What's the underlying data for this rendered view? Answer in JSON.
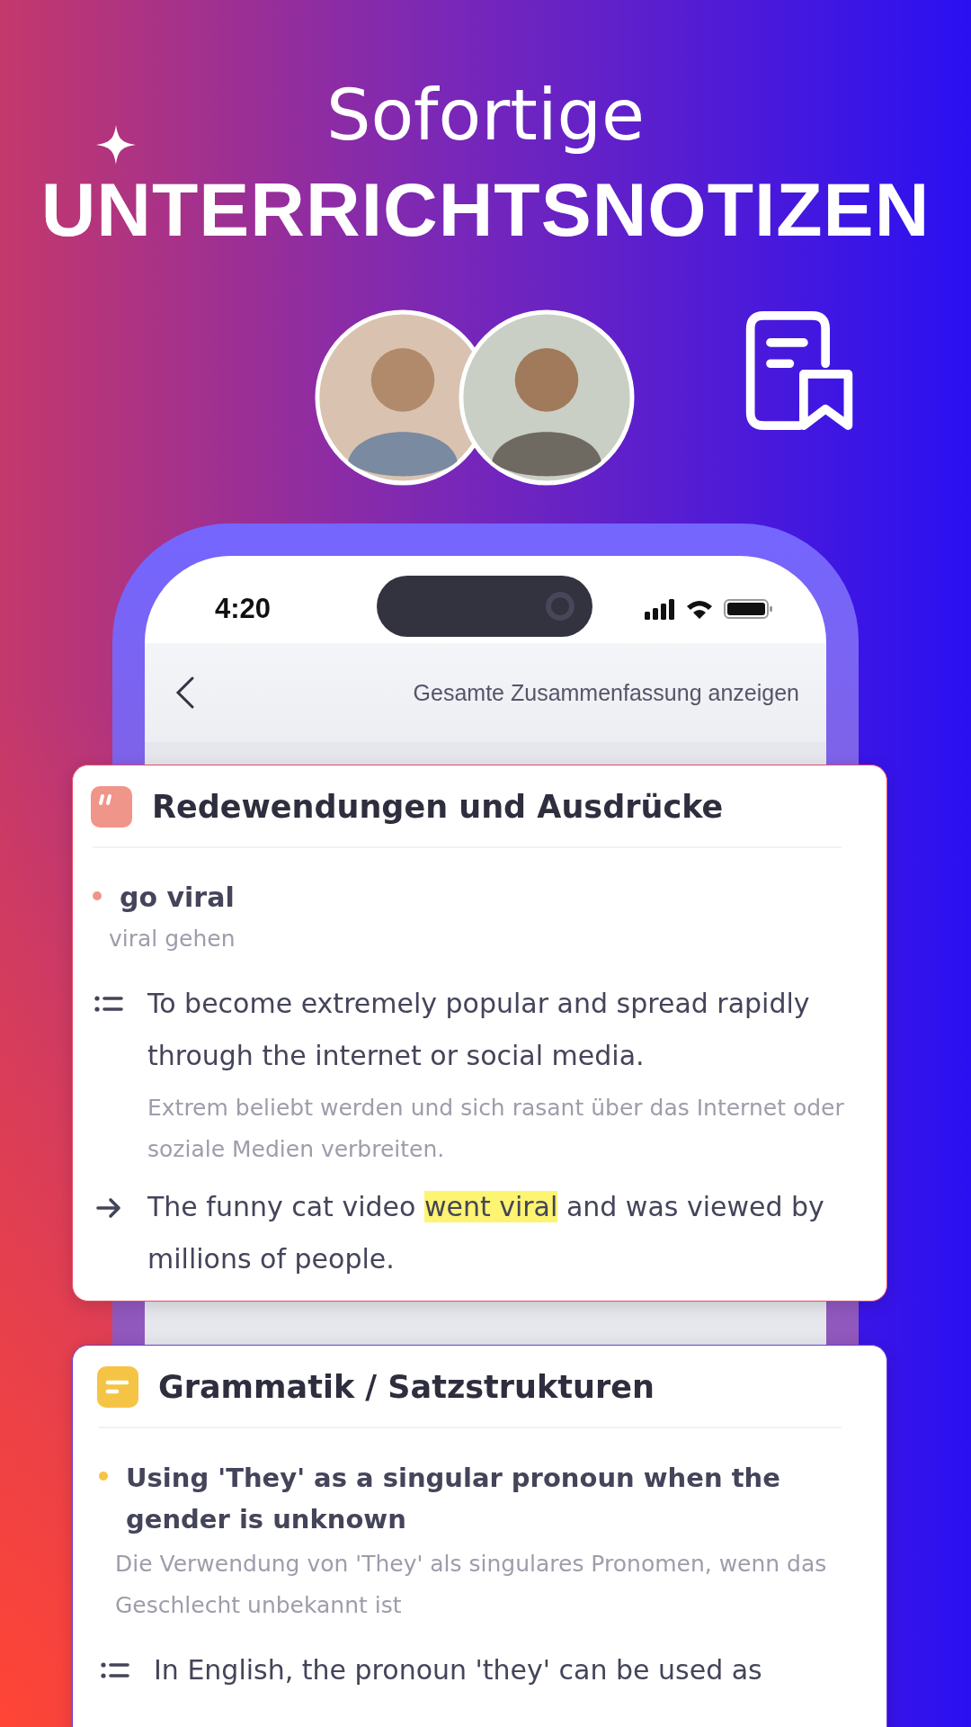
{
  "headline": {
    "line_1": "Sofortige",
    "line_2": "UNTERRICHTSNOTIZEN"
  },
  "phone": {
    "status_bar": {
      "time": "4:20"
    },
    "nav": {
      "link": "Gesamte Zusammenfassung anzeigen"
    }
  },
  "cards": [
    {
      "kind": "idiom",
      "title": "Redewendungen und Ausdrücke",
      "entries": [
        {
          "term": "go viral",
          "translation": "viral gehen",
          "definition": "To become extremely popular and spread rapidly through the internet or social media.",
          "definition_translation": "Extrem beliebt werden und sich rasant über das Internet oder soziale Medien verbreiten.",
          "example": {
            "before": "The funny cat video ",
            "highlight": "went viral",
            "after": " and was viewed by millions of people."
          }
        }
      ]
    },
    {
      "kind": "grammar",
      "title": "Grammatik / Satzstrukturen",
      "entries": [
        {
          "term": "Using 'They' as a singular pronoun when the gender is unknown",
          "translation": "Die Verwendung von 'They' als singulares Pronomen, wenn das Geschlecht unbekannt ist",
          "definition": "In English, the pronoun 'they' can be used as"
        }
      ]
    }
  ]
}
